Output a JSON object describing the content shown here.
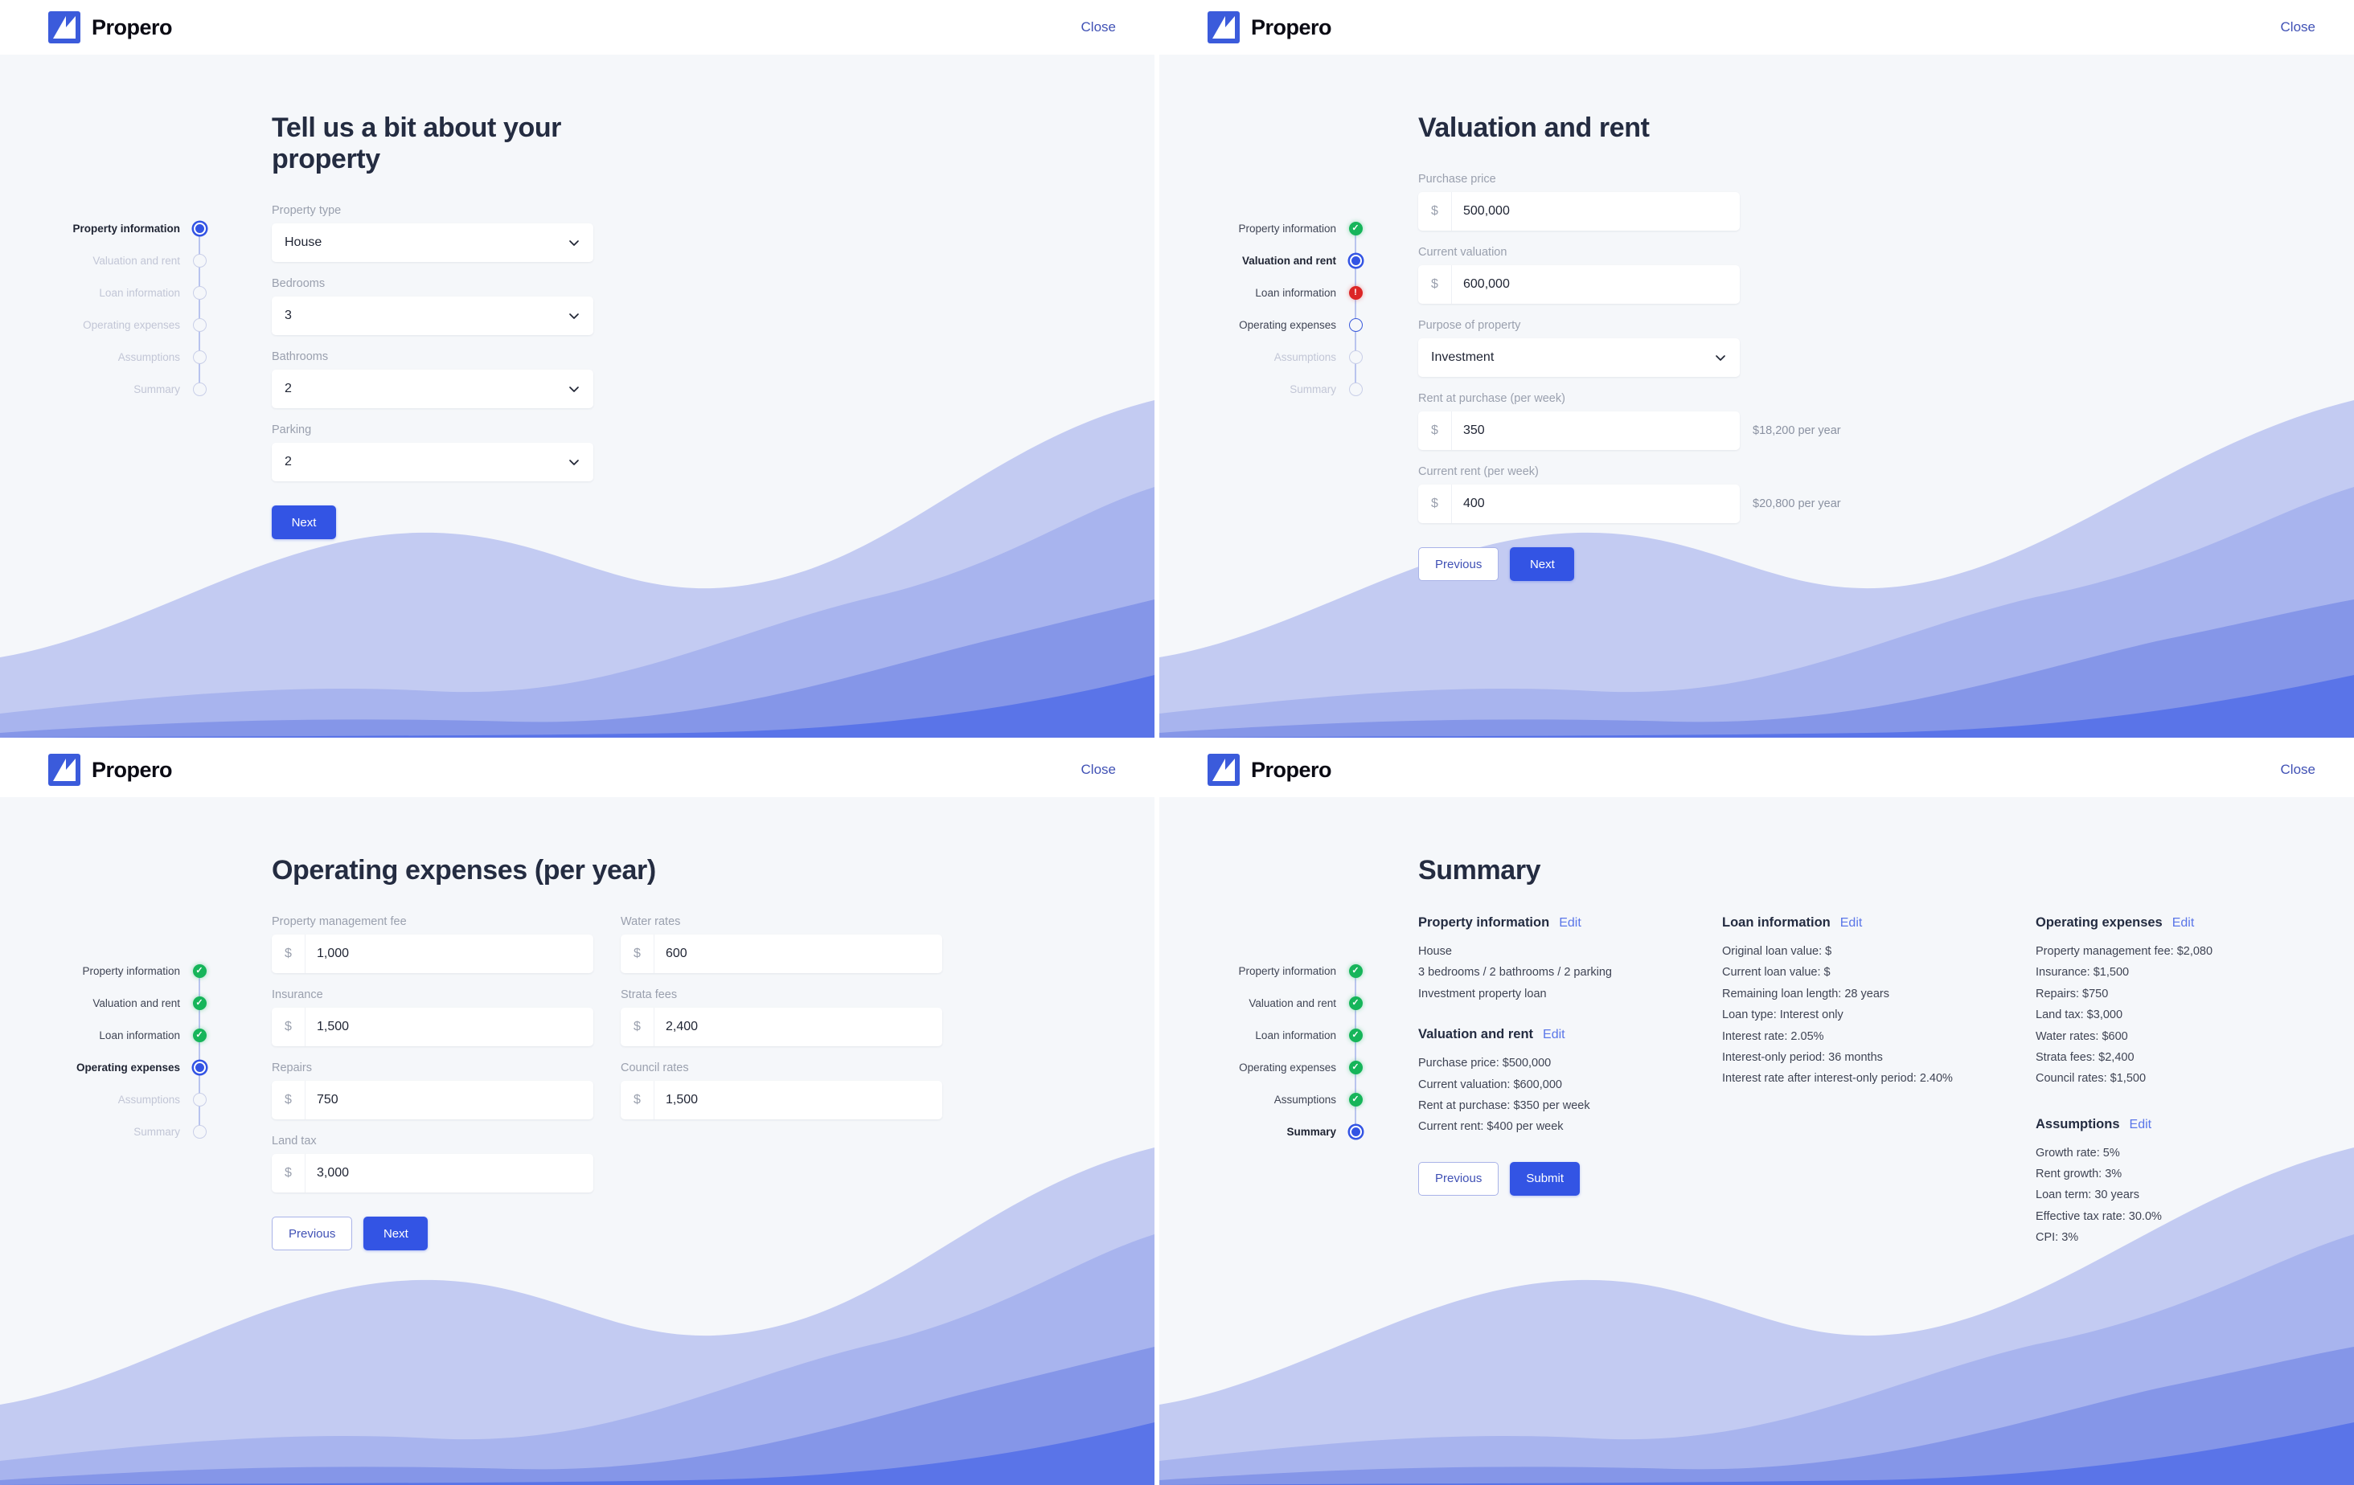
{
  "header": {
    "brand": "Propero",
    "close_label": "Close",
    "logo_icon": "propero-logo-icon"
  },
  "steps": {
    "property_information": "Property information",
    "valuation_and_rent": "Valuation and rent",
    "loan_information": "Loan information",
    "operating_expenses": "Operating expenses",
    "assumptions": "Assumptions",
    "summary": "Summary"
  },
  "panel1": {
    "title": "Tell us a bit about your property",
    "fields": [
      {
        "label": "Property type",
        "value": "House"
      },
      {
        "label": "Bedrooms",
        "value": "3"
      },
      {
        "label": "Bathrooms",
        "value": "2"
      },
      {
        "label": "Parking",
        "value": "2"
      }
    ],
    "next_label": "Next"
  },
  "panel2": {
    "title": "Valuation and rent",
    "fields": [
      {
        "label": "Purchase price",
        "prefix": "$",
        "value": "500,000",
        "note": ""
      },
      {
        "label": "Current valuation",
        "prefix": "$",
        "value": "600,000",
        "note": ""
      },
      {
        "label": "Purpose of property",
        "value": "Investment",
        "select": true
      },
      {
        "label": "Rent at purchase (per week)",
        "prefix": "$",
        "value": "350",
        "note": "$18,200 per year"
      },
      {
        "label": "Current rent (per week)",
        "prefix": "$",
        "value": "400",
        "note": "$20,800 per year"
      }
    ],
    "previous_label": "Previous",
    "next_label": "Next"
  },
  "panel3": {
    "title": "Operating expenses (per year)",
    "left_fields": [
      {
        "label": "Property management fee",
        "prefix": "$",
        "value": "1,000"
      },
      {
        "label": "Insurance",
        "prefix": "$",
        "value": "1,500"
      },
      {
        "label": "Repairs",
        "prefix": "$",
        "value": "750"
      },
      {
        "label": "Land tax",
        "prefix": "$",
        "value": "3,000"
      }
    ],
    "right_fields": [
      {
        "label": "Water rates",
        "prefix": "$",
        "value": "600"
      },
      {
        "label": "Strata fees",
        "prefix": "$",
        "value": "2,400"
      },
      {
        "label": "Council rates",
        "prefix": "$",
        "value": "1,500"
      }
    ],
    "previous_label": "Previous",
    "next_label": "Next"
  },
  "panel4": {
    "title": "Summary",
    "edit_label": "Edit",
    "groups_col1": [
      {
        "heading": "Property information",
        "lines": [
          "House",
          "3 bedrooms / 2 bathrooms / 2 parking",
          "Investment property loan"
        ]
      },
      {
        "heading": "Valuation and rent",
        "lines": [
          "Purchase price: $500,000",
          "Current valuation: $600,000",
          "Rent at purchase: $350 per week",
          "Current rent: $400 per week"
        ]
      }
    ],
    "groups_col2": [
      {
        "heading": "Loan information",
        "lines": [
          "Original loan value: $",
          "Current loan value: $",
          "Remaining loan length: 28 years",
          "Loan type: Interest only",
          "Interest rate: 2.05%",
          "Interest-only period: 36 months",
          "Interest rate after interest-only period: 2.40%"
        ]
      }
    ],
    "groups_col3": [
      {
        "heading": "Operating expenses",
        "lines": [
          "Property management fee: $2,080",
          "Insurance: $1,500",
          "Repairs: $750",
          "Land tax: $3,000",
          "Water rates: $600",
          "Strata fees: $2,400",
          "Council rates: $1,500"
        ]
      },
      {
        "heading": "Assumptions",
        "lines": [
          "Growth rate: 5%",
          "Rent growth: 3%",
          "Loan term: 30 years",
          "Effective tax rate: 30.0%",
          "CPI: 3%"
        ]
      }
    ],
    "previous_label": "Previous",
    "submit_label": "Submit"
  },
  "colors": {
    "brand_blue": "#3354e4",
    "logo_blue": "#3b5bdb",
    "link_blue": "#4051b5",
    "success_green": "#16b55a",
    "error_red": "#dc2626",
    "page_bg": "#f5f7fa",
    "heading": "#242c41"
  }
}
